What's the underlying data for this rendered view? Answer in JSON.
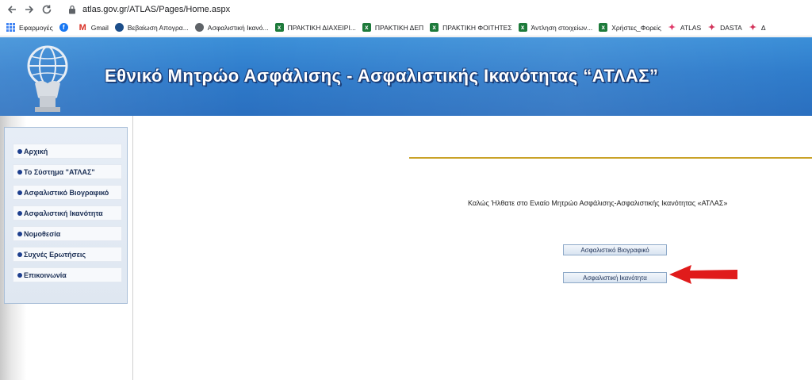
{
  "browser": {
    "url": "atlas.gov.gr/ATLAS/Pages/Home.aspx",
    "bookmarks": [
      {
        "label": "Εφαρμογές",
        "icon": "apps-icon"
      },
      {
        "label": "",
        "icon": "facebook-icon"
      },
      {
        "label": "Gmail",
        "icon": "gmail-icon"
      },
      {
        "label": "Βεβαίωση Απογρα...",
        "icon": "gov-icon"
      },
      {
        "label": "Ασφαλιστική Ικανό...",
        "icon": "globe-icon"
      },
      {
        "label": "ΠΡΑΚΤΙΚΗ ΔΙΑΧΕΙΡΙ...",
        "icon": "spreadsheet-icon"
      },
      {
        "label": "ΠΡΑΚΤΙΚΗ ΔΕΠ",
        "icon": "spreadsheet-icon"
      },
      {
        "label": "ΠΡΑΚΤΙΚΗ ΦΟΙΤΗΤΕΣ",
        "icon": "spreadsheet-icon"
      },
      {
        "label": "Άντληση στοιχείων...",
        "icon": "spreadsheet-icon"
      },
      {
        "label": "Χρήστες_Φορείς",
        "icon": "spreadsheet-icon"
      },
      {
        "label": "ATLAS",
        "icon": "atlas-icon"
      },
      {
        "label": "DASTA",
        "icon": "dasta-icon"
      },
      {
        "label": "Δ",
        "icon": "dasta-icon"
      }
    ]
  },
  "header": {
    "title": "Εθνικό Μητρώο Ασφάλισης - Ασφαλιστικής Ικανότητας “ΑΤΛΑΣ”"
  },
  "sidebar": {
    "items": [
      {
        "label": "Αρχική"
      },
      {
        "label": "Το Σύστημα \"ΑΤΛΑΣ\""
      },
      {
        "label": "Ασφαλιστικό Βιογραφικό"
      },
      {
        "label": "Ασφαλιστική Ικανότητα"
      },
      {
        "label": "Νομοθεσία"
      },
      {
        "label": "Συχνές Ερωτήσεις"
      },
      {
        "label": "Επικοινωνία"
      }
    ]
  },
  "main": {
    "welcome_text": "Καλώς Ήλθατε στο Ενιαίο Μητρώο Ασφάλισης-Ασφαλιστικής Ικανότητας «ΑΤΛΑΣ»",
    "buttons": {
      "bio": "Ασφαλιστικό Βιογραφικό",
      "ikanotita": "Ασφαλιστική Ικανότητα"
    }
  },
  "colors": {
    "banner_blue": "#2f7ccb",
    "gold_line": "#c9a227",
    "arrow_red": "#e01b1b",
    "menu_text": "#1b2f55"
  }
}
